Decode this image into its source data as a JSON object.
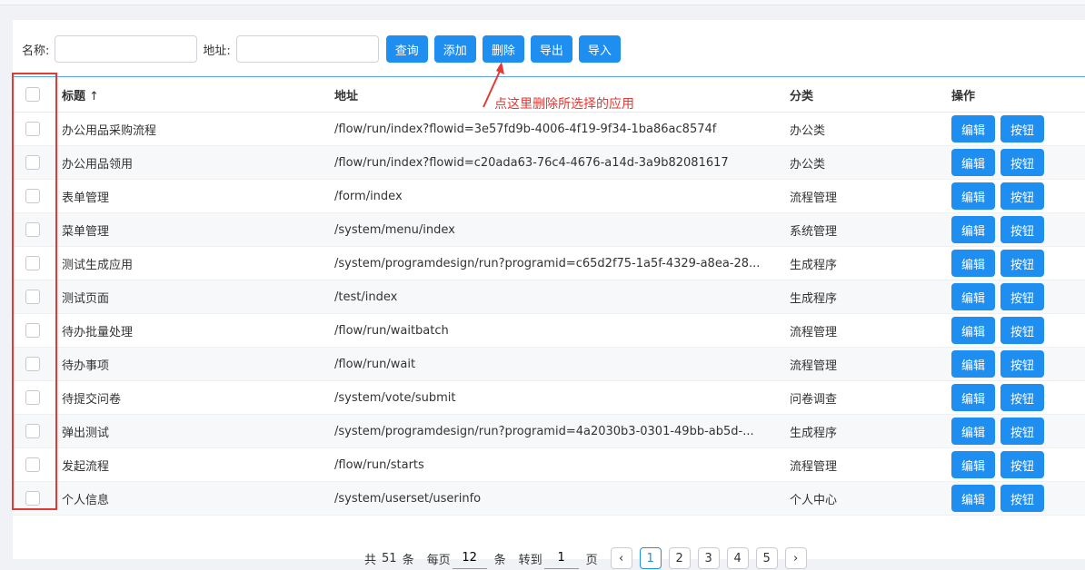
{
  "search": {
    "name_label": "名称:",
    "addr_label": "地址:",
    "name_value": "",
    "addr_value": ""
  },
  "toolbar": {
    "query": "查询",
    "add": "添加",
    "delete": "删除",
    "export": "导出",
    "import": "导入"
  },
  "table": {
    "headers": {
      "title": "标题",
      "title_sort_icon": "↑",
      "addr": "地址",
      "cat": "分类",
      "ops": "操作"
    },
    "rows": [
      {
        "title": "办公用品采购流程",
        "addr": "/flow/run/index?flowid=3e57fd9b-4006-4f19-9f34-1ba86ac8574f",
        "cat": "办公类"
      },
      {
        "title": "办公用品领用",
        "addr": "/flow/run/index?flowid=c20ada63-76c4-4676-a14d-3a9b82081617",
        "cat": "办公类"
      },
      {
        "title": "表单管理",
        "addr": "/form/index",
        "cat": "流程管理"
      },
      {
        "title": "菜单管理",
        "addr": "/system/menu/index",
        "cat": "系统管理"
      },
      {
        "title": "测试生成应用",
        "addr": "/system/programdesign/run?programid=c65d2f75-1a5f-4329-a8ea-28...",
        "cat": "生成程序"
      },
      {
        "title": "测试页面",
        "addr": "/test/index",
        "cat": "生成程序"
      },
      {
        "title": "待办批量处理",
        "addr": "/flow/run/waitbatch",
        "cat": "流程管理"
      },
      {
        "title": "待办事项",
        "addr": "/flow/run/wait",
        "cat": "流程管理"
      },
      {
        "title": "待提交问卷",
        "addr": "/system/vote/submit",
        "cat": "问卷调查"
      },
      {
        "title": "弹出测试",
        "addr": "/system/programdesign/run?programid=4a2030b3-0301-49bb-ab5d-...",
        "cat": "生成程序"
      },
      {
        "title": "发起流程",
        "addr": "/flow/run/starts",
        "cat": "流程管理"
      },
      {
        "title": "个人信息",
        "addr": "/system/userset/userinfo",
        "cat": "个人中心"
      }
    ],
    "edit_label": "编辑",
    "button_label": "按钮"
  },
  "annotation": {
    "note": "点这里删除所选择的应用",
    "color": "#e53935"
  },
  "pager": {
    "total_prefix": "共",
    "total": "51",
    "total_suffix": "条",
    "per_page_prefix": "每页",
    "per_page": "12",
    "per_page_suffix": "条",
    "goto_prefix": "转到",
    "goto_value": "1",
    "goto_suffix": "页",
    "prev_icon": "‹",
    "next_icon": "›",
    "pages": [
      "1",
      "2",
      "3",
      "4",
      "5"
    ],
    "current": "1"
  },
  "colors": {
    "primary": "#1f8ef1",
    "annotation": "#e53935"
  }
}
